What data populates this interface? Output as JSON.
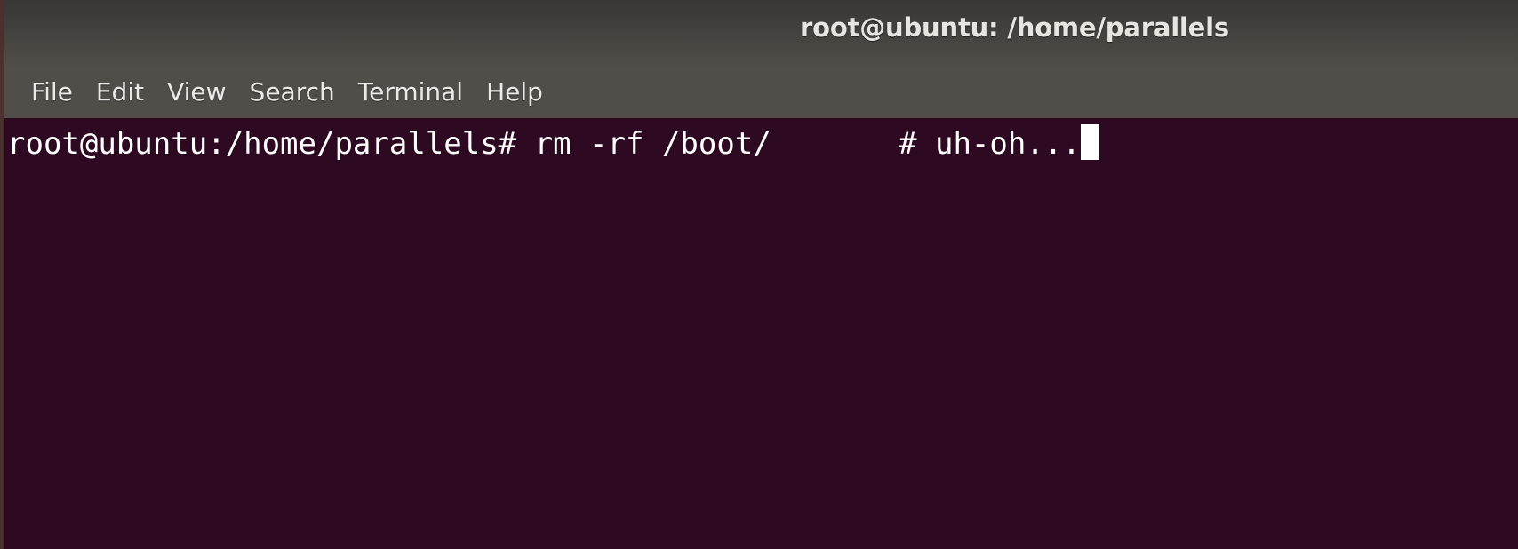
{
  "window": {
    "title": "root@ubuntu: /home/parallels",
    "border_color": "#4a312f"
  },
  "menubar": {
    "items": [
      {
        "label": "File"
      },
      {
        "label": "Edit"
      },
      {
        "label": "View"
      },
      {
        "label": "Search"
      },
      {
        "label": "Terminal"
      },
      {
        "label": "Help"
      }
    ]
  },
  "terminal": {
    "background_color": "#2d0a21",
    "foreground_color": "#ffffff",
    "prompt": "root@ubuntu:/home/parallels#",
    "command": " rm -rf /boot/",
    "gap": "       ",
    "comment": "# uh-oh...",
    "cursor": "block-cursor",
    "full_line": "root@ubuntu:/home/parallels# rm -rf /boot/       # uh-oh..."
  }
}
